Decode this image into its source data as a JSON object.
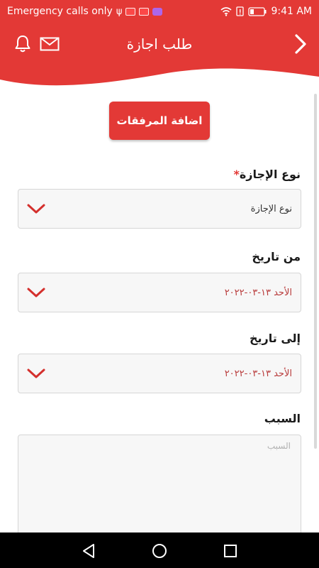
{
  "status_bar": {
    "carrier_text": "Emergency calls only",
    "time": "9:41 AM"
  },
  "header": {
    "title": "طلب اجازة"
  },
  "attach_button": {
    "label": "اضافة المرفقات"
  },
  "form": {
    "leave_type": {
      "label": "نوع الإجازة",
      "required_mark": "*",
      "value": "نوع الإجازة"
    },
    "from_date": {
      "label": "من تاريخ",
      "value": "الأحد ١٣-٠٣-٢٠٢٢"
    },
    "to_date": {
      "label": "إلى تاريخ",
      "value": "الأحد ١٣-٠٣-٢٠٢٢"
    },
    "reason": {
      "label": "السبب",
      "placeholder": "السبب"
    }
  },
  "colors": {
    "brand_red": "#e33936",
    "date_text": "#b83a3a",
    "field_bg": "#f7f7f7"
  },
  "icons": {
    "bell": "bell-icon",
    "mail": "mail-icon",
    "back": "chevron-right-icon",
    "dropdown": "chevron-down-icon",
    "nav_back": "triangle-back-icon",
    "nav_home": "circle-home-icon",
    "nav_recent": "square-recent-icon"
  }
}
